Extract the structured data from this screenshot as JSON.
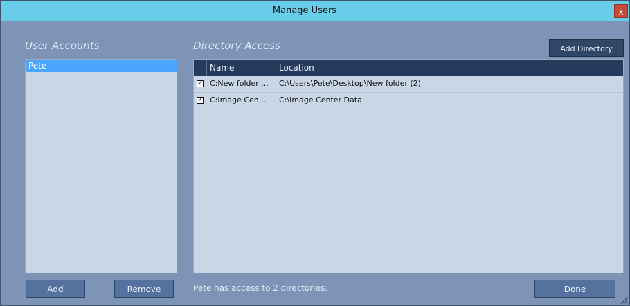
{
  "window": {
    "title": "Manage Users",
    "close_glyph": "x"
  },
  "left": {
    "title": "User Accounts",
    "users": [
      "Pete"
    ],
    "add_label": "Add",
    "remove_label": "Remove"
  },
  "right": {
    "title": "Directory Access",
    "add_directory_label": "Add Directory",
    "columns": {
      "name": "Name",
      "location": "Location"
    },
    "rows": [
      {
        "checked": true,
        "name": "C:New folder ...",
        "location": "C:\\Users\\Pete\\Desktop\\New folder (2)"
      },
      {
        "checked": true,
        "name": "C:Image Cen...",
        "location": "C:\\Image Center Data"
      }
    ],
    "status": "Pete has access to 2 directories:",
    "done_label": "Done"
  },
  "colors": {
    "titlebar": "#67cde8",
    "background": "#7d94b7",
    "selection": "#4aa6ff",
    "table_header": "#263b5b"
  },
  "icons": {
    "checkbox": "check-icon",
    "close": "close-icon",
    "resize": "resize-grip-icon"
  }
}
